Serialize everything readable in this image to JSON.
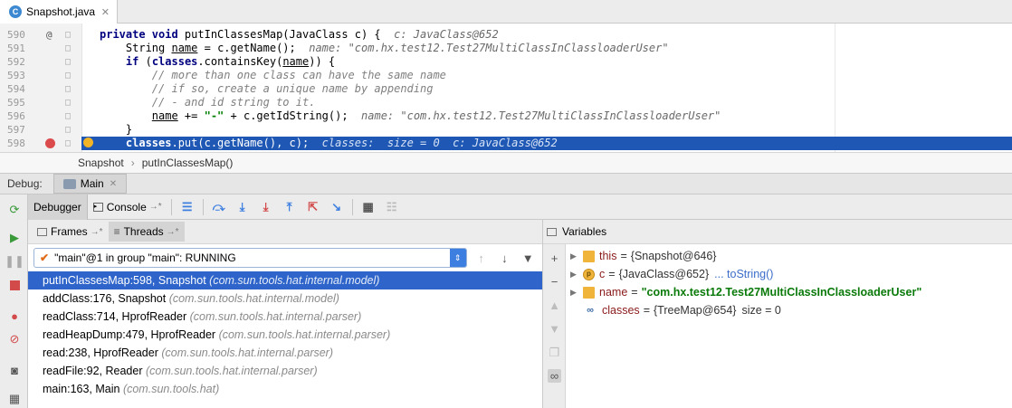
{
  "editor_tab": {
    "file_name": "Snapshot.java",
    "lang_icon": "C"
  },
  "code_lines": [
    {
      "ln": "590",
      "mark": "@",
      "parts": [
        {
          "c": "kw",
          "t": "private void "
        },
        {
          "c": "",
          "t": "putInClassesMap(JavaClass c) {  "
        },
        {
          "c": "hint",
          "t": "c: JavaClass@652"
        }
      ]
    },
    {
      "ln": "591",
      "mark": "",
      "parts": [
        {
          "c": "",
          "t": "    String "
        },
        {
          "c": "ul",
          "t": "name"
        },
        {
          "c": "",
          "t": " = c.getName();  "
        },
        {
          "c": "hint",
          "t": "name: \"com.hx.test12.Test27MultiClassInClassloaderUser\""
        }
      ]
    },
    {
      "ln": "592",
      "mark": "",
      "parts": [
        {
          "c": "",
          "t": "    "
        },
        {
          "c": "kw",
          "t": "if "
        },
        {
          "c": "",
          "t": "("
        },
        {
          "c": "kw",
          "t": "classes"
        },
        {
          "c": "",
          "t": ".containsKey("
        },
        {
          "c": "ul",
          "t": "name"
        },
        {
          "c": "",
          "t": ")) {"
        }
      ]
    },
    {
      "ln": "593",
      "mark": "",
      "parts": [
        {
          "c": "cm",
          "t": "        // more than one class can have the same name"
        }
      ]
    },
    {
      "ln": "594",
      "mark": "",
      "parts": [
        {
          "c": "cm",
          "t": "        // if so, create a unique name by appending"
        }
      ]
    },
    {
      "ln": "595",
      "mark": "",
      "parts": [
        {
          "c": "cm",
          "t": "        // - and id string to it."
        }
      ]
    },
    {
      "ln": "596",
      "mark": "",
      "parts": [
        {
          "c": "",
          "t": "        "
        },
        {
          "c": "ul",
          "t": "name"
        },
        {
          "c": "",
          "t": " += "
        },
        {
          "c": "str",
          "t": "\"-\""
        },
        {
          "c": "",
          "t": " + c.getIdString();  "
        },
        {
          "c": "hint",
          "t": "name: \"com.hx.test12.Test27MultiClassInClassloaderUser\""
        }
      ]
    },
    {
      "ln": "597",
      "mark": "",
      "parts": [
        {
          "c": "",
          "t": "    }"
        }
      ]
    },
    {
      "ln": "598",
      "mark": "bp",
      "current": true,
      "parts": [
        {
          "c": "",
          "t": "    "
        },
        {
          "c": "kw",
          "t": "classes"
        },
        {
          "c": "",
          "t": ".put(c.getName(), c);  "
        },
        {
          "c": "hint",
          "t": "classes:  size = 0  c: JavaClass@652"
        }
      ]
    }
  ],
  "breadcrumb": {
    "class": "Snapshot",
    "method": "putInClassesMap()"
  },
  "debug": {
    "label": "Debug:",
    "run_config": "Main",
    "tabs": {
      "debugger": "Debugger",
      "console": "Console"
    }
  },
  "frames": {
    "tab_frames": "Frames",
    "tab_threads": "Threads",
    "thread_selected": "\"main\"@1 in group \"main\": RUNNING",
    "items": [
      {
        "method": "putInClassesMap:598, Snapshot",
        "pkg": "(com.sun.tools.hat.internal.model)"
      },
      {
        "method": "addClass:176, Snapshot",
        "pkg": "(com.sun.tools.hat.internal.model)"
      },
      {
        "method": "readClass:714, HprofReader",
        "pkg": "(com.sun.tools.hat.internal.parser)"
      },
      {
        "method": "readHeapDump:479, HprofReader",
        "pkg": "(com.sun.tools.hat.internal.parser)"
      },
      {
        "method": "read:238, HprofReader",
        "pkg": "(com.sun.tools.hat.internal.parser)"
      },
      {
        "method": "readFile:92, Reader",
        "pkg": "(com.sun.tools.hat.internal.parser)"
      },
      {
        "method": "main:163, Main",
        "pkg": "(com.sun.tools.hat)"
      }
    ]
  },
  "variables": {
    "title": "Variables",
    "items": [
      {
        "icon": "field",
        "name": "this",
        "value": "{Snapshot@646}",
        "expandable": true
      },
      {
        "icon": "param",
        "icon_letter": "p",
        "name": "c",
        "value": "{JavaClass@652}",
        "link": "... toString()",
        "expandable": true
      },
      {
        "icon": "field",
        "name": "name",
        "value": "\"com.hx.test12.Test27MultiClassInClassloaderUser\"",
        "is_string": true,
        "expandable": true
      },
      {
        "icon": "watch",
        "name": "classes",
        "value": "{TreeMap@654}",
        "extra": "size = 0",
        "expandable": false
      }
    ]
  }
}
